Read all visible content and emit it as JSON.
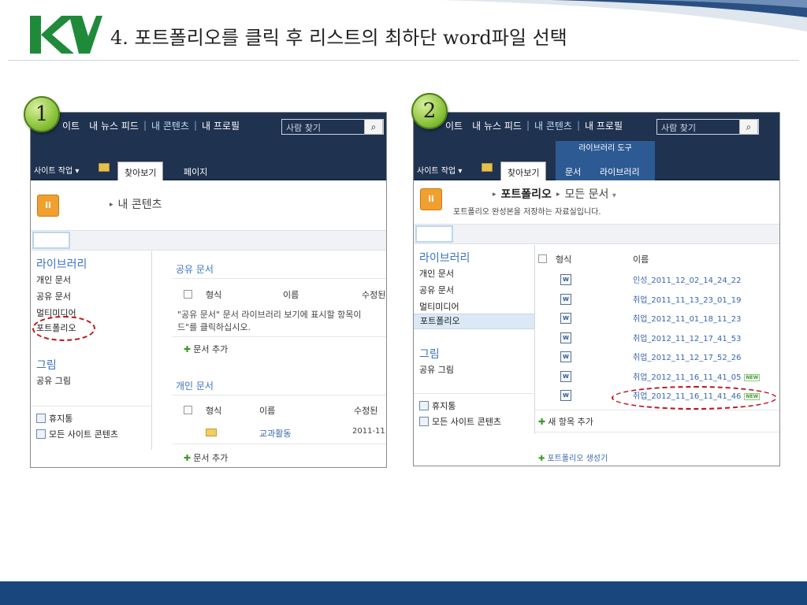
{
  "slide": {
    "title": "4. 포트폴리오를 클릭 후 리스트의 최하단 word파일 선택"
  },
  "colors": {
    "topbar": "#1f3250",
    "link": "#3966b0",
    "highlight": "#c0121b",
    "footer": "#1a467e"
  },
  "panel1": {
    "badge": "1",
    "nav": [
      "이트",
      "내 뉴스 피드",
      "내 콘텐츠",
      "내 프로필"
    ],
    "search_placeholder": "사람 찾기",
    "site_actions": "사이트 작업 ▾",
    "tabs": [
      "찾아보기",
      "페이지"
    ],
    "breadcrumb_arrow": "▸",
    "breadcrumb": "내 콘텐츠",
    "left_nav": {
      "libraries_heading": "라이브러리",
      "libraries": [
        "개인 문서",
        "공유 문서",
        "멀티미디어",
        "포트폴리오"
      ],
      "pictures_heading": "그림",
      "pictures": [
        "공유 그림"
      ],
      "bottom": [
        "휴지통",
        "모든 사이트 콘텐츠"
      ]
    },
    "shared_docs": {
      "heading": "공유 문서",
      "columns": [
        "형식",
        "이름",
        "수정된"
      ],
      "message_line1": "\"공유 문서\" 문서 라이브러리 보기에 표시할 항목이",
      "message_line2": "드\"를 클릭하십시오.",
      "add": "문서 추가"
    },
    "personal_docs": {
      "heading": "개인 문서",
      "columns": [
        "형식",
        "이름",
        "수정된"
      ],
      "row_name": "교과활동",
      "row_date": "2011-11",
      "add": "문서 추가"
    }
  },
  "panel2": {
    "badge": "2",
    "nav": [
      "이트",
      "내 뉴스 피드",
      "내 콘텐츠",
      "내 프로필"
    ],
    "search_placeholder": "사람 찾기",
    "site_actions": "사이트 작업 ▾",
    "library_tools": "라이브러리 도구",
    "tabs": [
      "찾아보기",
      "문서",
      "라이브러리"
    ],
    "breadcrumb": [
      "포트폴리오",
      "모든 문서"
    ],
    "description": "포트폴리오 완성본을 저장하는 자료실입니다.",
    "left_nav": {
      "libraries_heading": "라이브러리",
      "libraries": [
        "개인 문서",
        "공유 문서",
        "멀티미디어",
        "포트폴리오"
      ],
      "pictures_heading": "그림",
      "pictures": [
        "공유 그림"
      ],
      "bottom": [
        "휴지통",
        "모든 사이트 콘텐츠"
      ]
    },
    "list": {
      "columns": [
        "형식",
        "이름"
      ],
      "files": [
        {
          "name": "인성_2011_12_02_14_24_22",
          "new": ""
        },
        {
          "name": "취업_2011_11_13_23_01_19",
          "new": ""
        },
        {
          "name": "취업_2012_11_01_18_11_23",
          "new": ""
        },
        {
          "name": "취업_2012_11_12_17_41_53",
          "new": ""
        },
        {
          "name": "취업_2012_11_12_17_52_26",
          "new": ""
        },
        {
          "name": "취업_2012_11_16_11_41_05",
          "new": "NEW"
        },
        {
          "name": "취업_2012_11_16_11_41_46",
          "new": "NEW"
        }
      ],
      "add_item": "새 항목 추가",
      "generator": "포트폴리오 생성기"
    }
  }
}
